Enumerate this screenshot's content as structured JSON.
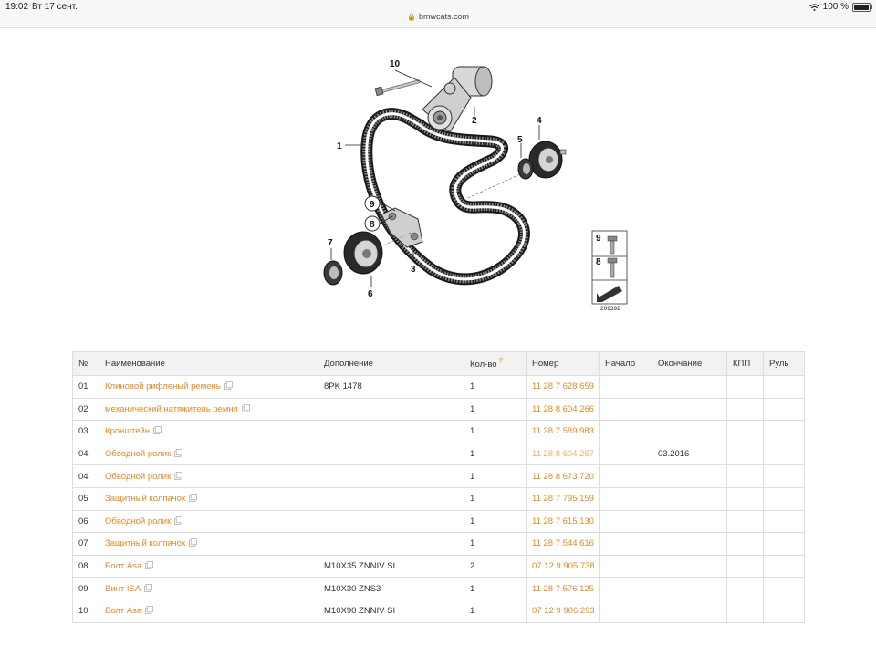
{
  "status_bar": {
    "time": "19:02",
    "date": "Вт 17 сент.",
    "battery": "100 %",
    "url": "bmwcats.com"
  },
  "diagram": {
    "callouts": [
      "10",
      "2",
      "1",
      "5",
      "4",
      "9",
      "8",
      "7",
      "3",
      "6"
    ],
    "legend_labels": [
      "9",
      "8"
    ],
    "image_id": "209392"
  },
  "table": {
    "headers": {
      "num": "№",
      "name": "Наименование",
      "addition": "Дополнение",
      "qty": "Кол-во",
      "qty_help": "?",
      "number": "Номер",
      "start": "Начало",
      "end": "Окончание",
      "gearbox": "КПП",
      "steering": "Руль"
    },
    "rows": [
      {
        "num": "01",
        "name": "Клиновой рифленый ремень",
        "addition": "8PK 1478",
        "qty": "1",
        "number": "11 28 7 628 659",
        "start": "",
        "end": "",
        "gearbox": "",
        "steering": ""
      },
      {
        "num": "02",
        "name": "механический натяжитель ремня",
        "addition": "",
        "qty": "1",
        "number": "11 28 8 604 266",
        "start": "",
        "end": "",
        "gearbox": "",
        "steering": ""
      },
      {
        "num": "03",
        "name": "Кронштейн",
        "addition": "",
        "qty": "1",
        "number": "11 28 7 589 983",
        "start": "",
        "end": "",
        "gearbox": "",
        "steering": ""
      },
      {
        "num": "04",
        "name": "Обводной ролик",
        "addition": "",
        "qty": "1",
        "number": "11 28 8 604 267",
        "start": "",
        "end": "03.2016",
        "gearbox": "",
        "steering": "",
        "discontinued": true
      },
      {
        "num": "04",
        "name": "Обводной ролик",
        "addition": "",
        "qty": "1",
        "number": "11 28 8 673 720",
        "start": "",
        "end": "",
        "gearbox": "",
        "steering": ""
      },
      {
        "num": "05",
        "name": "Защитный колпачок",
        "addition": "",
        "qty": "1",
        "number": "11 28 7 795 159",
        "start": "",
        "end": "",
        "gearbox": "",
        "steering": ""
      },
      {
        "num": "06",
        "name": "Обводной ролик",
        "addition": "",
        "qty": "1",
        "number": "11 28 7 615 130",
        "start": "",
        "end": "",
        "gearbox": "",
        "steering": ""
      },
      {
        "num": "07",
        "name": "Защитный колпачок",
        "addition": "",
        "qty": "1",
        "number": "11 28 7 544 616",
        "start": "",
        "end": "",
        "gearbox": "",
        "steering": ""
      },
      {
        "num": "08",
        "name": "Болт Asa",
        "addition": "M10X35 ZNNIV SI",
        "qty": "2",
        "number": "07 12 9 905 738",
        "start": "",
        "end": "",
        "gearbox": "",
        "steering": ""
      },
      {
        "num": "09",
        "name": "Винт ISA",
        "addition": "M10X30 ZNS3",
        "qty": "1",
        "number": "11 28 7 576 125",
        "start": "",
        "end": "",
        "gearbox": "",
        "steering": ""
      },
      {
        "num": "10",
        "name": "Болт Asa",
        "addition": "M10X90 ZNNIV SI",
        "qty": "1",
        "number": "07 12 9 906 293",
        "start": "",
        "end": "",
        "gearbox": "",
        "steering": ""
      }
    ]
  },
  "colors": {
    "link": "#e08a2c",
    "header_bg": "#f2f2f2",
    "border": "#dddddd"
  },
  "icons": {
    "external": "external-link-icon",
    "wifi": "wifi-icon",
    "battery": "battery-icon",
    "lock": "lock-icon"
  }
}
